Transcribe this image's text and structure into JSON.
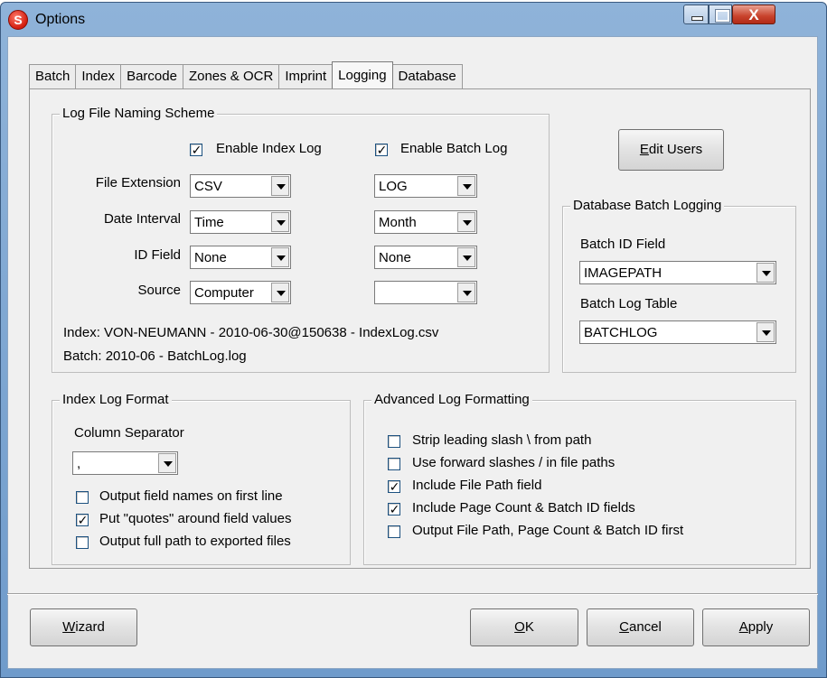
{
  "window": {
    "title": "Options",
    "logo_letter": "S",
    "close_glyph": "X"
  },
  "tabs": [
    {
      "label": "Batch"
    },
    {
      "label": "Index"
    },
    {
      "label": "Barcode"
    },
    {
      "label": "Zones & OCR"
    },
    {
      "label": "Imprint"
    },
    {
      "label": "Logging",
      "active": true
    },
    {
      "label": "Database"
    }
  ],
  "log_naming": {
    "title": "Log File Naming Scheme",
    "enable_index_log": {
      "label": "Enable Index Log",
      "checked": true
    },
    "enable_batch_log": {
      "label": "Enable Batch Log",
      "checked": true
    },
    "rows": {
      "file_extension": {
        "label": "File Extension",
        "index_value": "CSV",
        "batch_value": "LOG"
      },
      "date_interval": {
        "label": "Date Interval",
        "index_value": "Time",
        "batch_value": "Month"
      },
      "id_field": {
        "label": "ID Field",
        "index_value": "None",
        "batch_value": "None"
      },
      "source": {
        "label": "Source",
        "index_value": "Computer",
        "batch_value": ""
      }
    },
    "index_preview": "Index:  VON-NEUMANN - 2010-06-30@150638 - IndexLog.csv",
    "batch_preview": "Batch: 2010-06 - BatchLog.log"
  },
  "edit_users": {
    "prefix": "",
    "accel": "E",
    "rest": "dit Users"
  },
  "db_logging": {
    "title": "Database Batch Logging",
    "batch_id_label": "Batch ID Field",
    "batch_id_value": "IMAGEPATH",
    "batch_table_label": "Batch Log Table",
    "batch_table_value": "BATCHLOG"
  },
  "index_format": {
    "title": "Index Log Format",
    "separator_label": "Column Separator",
    "separator_value": ",",
    "options": [
      {
        "label": "Output field names on first line",
        "checked": false
      },
      {
        "label": "Put \"quotes\" around field values",
        "checked": true
      },
      {
        "label": "Output full path to exported files",
        "checked": false
      }
    ]
  },
  "advanced": {
    "title": "Advanced Log Formatting",
    "options": [
      {
        "label": "Strip leading slash \\ from path",
        "checked": false
      },
      {
        "label": "Use forward slashes / in file paths",
        "checked": false
      },
      {
        "label": "Include File Path field",
        "checked": true
      },
      {
        "label": "Include Page Count & Batch ID fields",
        "checked": true
      },
      {
        "label": "Output File Path, Page Count & Batch ID first",
        "checked": false
      }
    ]
  },
  "footer": {
    "wizard": {
      "accel": "W",
      "rest": "izard"
    },
    "ok": {
      "accel": "O",
      "rest": "K"
    },
    "cancel": {
      "accel": "C",
      "rest": "ancel"
    },
    "apply": {
      "accel": "A",
      "rest": "pply"
    }
  },
  "check_glyph": "✓"
}
